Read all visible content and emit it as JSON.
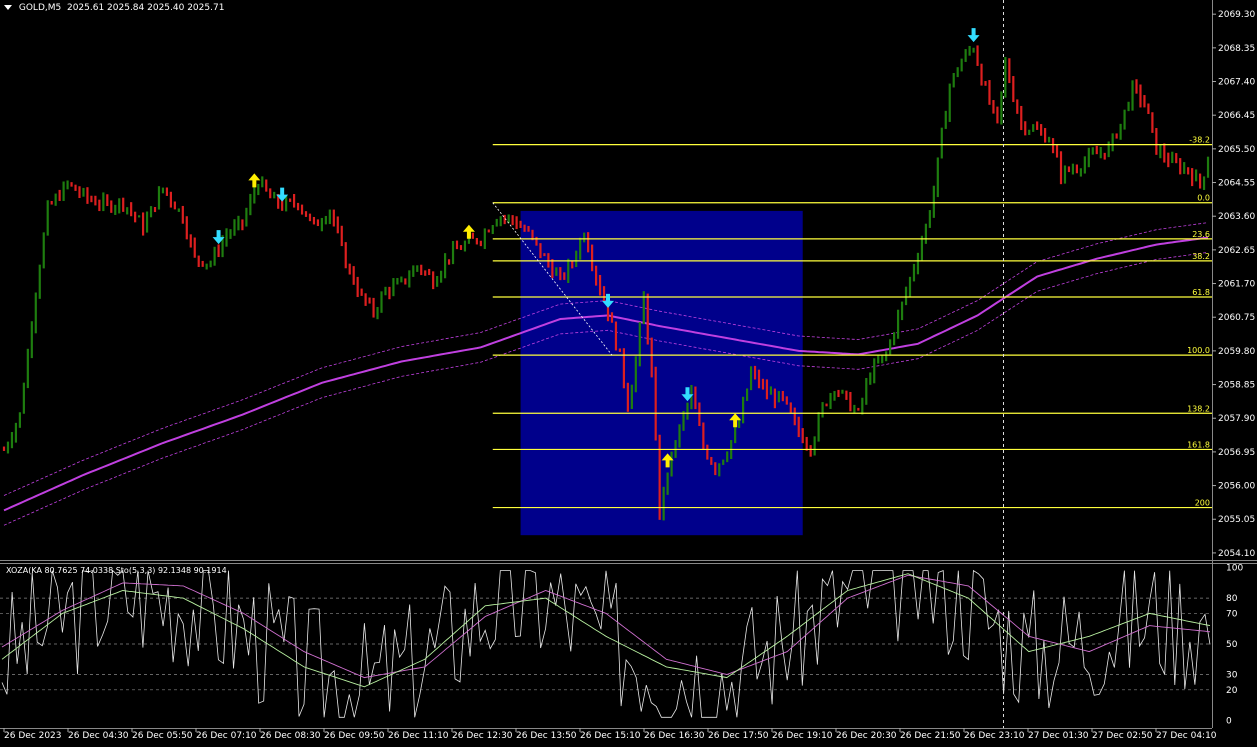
{
  "header": {
    "symbol": "GOLD,M5",
    "ohlc": "2025.61 2025.84 2025.40 2025.71"
  },
  "indicator_header": {
    "text": "XOZA(KA 80.7625 74.0338 Sto(5,3,3) 92.1348 90.1914"
  },
  "colors": {
    "background": "#000000",
    "bull_candle": "#1e7d0f",
    "bear_candle": "#dd1f1f",
    "fib_line": "#ffff3c",
    "fib_box": "#00008b",
    "ma_line": "#c040e0",
    "arrow_up": "#ffee00",
    "arrow_down": "#33ddff"
  },
  "chart_data": [
    {
      "type": "candlestick",
      "title": "GOLD,M5",
      "y_ticks": [
        "2069.30",
        "2068.35",
        "2067.40",
        "2066.45",
        "2065.50",
        "2064.55",
        "2063.60",
        "2062.65",
        "2061.70",
        "2060.75",
        "2059.80",
        "2058.85",
        "2057.90",
        "2056.95",
        "2056.00",
        "2055.05",
        "2054.10"
      ],
      "ylim": [
        2053.9,
        2069.7
      ],
      "x_ticks": [
        "26 Dec 2023",
        "26 Dec 04:30",
        "26 Dec 05:50",
        "26 Dec 07:10",
        "26 Dec 08:30",
        "26 Dec 09:50",
        "26 Dec 11:10",
        "26 Dec 12:30",
        "26 Dec 13:50",
        "26 Dec 15:10",
        "26 Dec 16:30",
        "26 Dec 17:50",
        "26 Dec 19:10",
        "26 Dec 20:30",
        "26 Dec 21:50",
        "26 Dec 23:10",
        "27 Dec 01:30",
        "27 Dec 02:50",
        "27 Dec 04:10"
      ],
      "close_path": [
        {
          "i": 0,
          "p": 2057.0
        },
        {
          "i": 4,
          "p": 2058.0
        },
        {
          "i": 8,
          "p": 2061.5
        },
        {
          "i": 11,
          "p": 2063.8
        },
        {
          "i": 16,
          "p": 2064.5
        },
        {
          "i": 21,
          "p": 2064.1
        },
        {
          "i": 26,
          "p": 2063.9
        },
        {
          "i": 30,
          "p": 2064.0
        },
        {
          "i": 35,
          "p": 2063.3
        },
        {
          "i": 40,
          "p": 2064.4
        },
        {
          "i": 45,
          "p": 2063.6
        },
        {
          "i": 48,
          "p": 2062.4
        },
        {
          "i": 52,
          "p": 2062.3
        },
        {
          "i": 56,
          "p": 2063.1
        },
        {
          "i": 60,
          "p": 2063.4
        },
        {
          "i": 64,
          "p": 2064.6
        },
        {
          "i": 67,
          "p": 2064.1
        },
        {
          "i": 70,
          "p": 2063.9
        },
        {
          "i": 74,
          "p": 2064.0
        },
        {
          "i": 78,
          "p": 2063.3
        },
        {
          "i": 82,
          "p": 2063.8
        },
        {
          "i": 86,
          "p": 2062.3
        },
        {
          "i": 90,
          "p": 2061.3
        },
        {
          "i": 93,
          "p": 2060.9
        },
        {
          "i": 96,
          "p": 2061.5
        },
        {
          "i": 100,
          "p": 2061.7
        },
        {
          "i": 104,
          "p": 2062.2
        },
        {
          "i": 108,
          "p": 2061.8
        },
        {
          "i": 112,
          "p": 2062.5
        },
        {
          "i": 116,
          "p": 2062.8
        },
        {
          "i": 120,
          "p": 2063.0
        },
        {
          "i": 124,
          "p": 2063.6
        },
        {
          "i": 128,
          "p": 2063.5
        },
        {
          "i": 132,
          "p": 2063.1
        },
        {
          "i": 136,
          "p": 2062.4
        },
        {
          "i": 140,
          "p": 2061.8
        },
        {
          "i": 143,
          "p": 2062.3
        },
        {
          "i": 146,
          "p": 2063.2
        },
        {
          "i": 149,
          "p": 2061.9
        },
        {
          "i": 152,
          "p": 2060.9
        },
        {
          "i": 155,
          "p": 2059.6
        },
        {
          "i": 157,
          "p": 2058.3
        },
        {
          "i": 159,
          "p": 2059.5
        },
        {
          "i": 161,
          "p": 2061.3
        },
        {
          "i": 163,
          "p": 2059.1
        },
        {
          "i": 165,
          "p": 2055.2
        },
        {
          "i": 167,
          "p": 2056.4
        },
        {
          "i": 170,
          "p": 2057.6
        },
        {
          "i": 173,
          "p": 2058.6
        },
        {
          "i": 176,
          "p": 2057.1
        },
        {
          "i": 179,
          "p": 2056.5
        },
        {
          "i": 182,
          "p": 2057.0
        },
        {
          "i": 185,
          "p": 2057.8
        },
        {
          "i": 188,
          "p": 2059.2
        },
        {
          "i": 192,
          "p": 2058.6
        },
        {
          "i": 196,
          "p": 2058.4
        },
        {
          "i": 200,
          "p": 2057.5
        },
        {
          "i": 203,
          "p": 2057.1
        },
        {
          "i": 206,
          "p": 2058.2
        },
        {
          "i": 209,
          "p": 2058.8
        },
        {
          "i": 212,
          "p": 2058.4
        },
        {
          "i": 215,
          "p": 2058.0
        },
        {
          "i": 218,
          "p": 2059.2
        },
        {
          "i": 222,
          "p": 2059.7
        },
        {
          "i": 226,
          "p": 2061.1
        },
        {
          "i": 229,
          "p": 2062.2
        },
        {
          "i": 232,
          "p": 2063.3
        },
        {
          "i": 234,
          "p": 2064.3
        },
        {
          "i": 236,
          "p": 2065.9
        },
        {
          "i": 238,
          "p": 2067.3
        },
        {
          "i": 241,
          "p": 2068.0
        },
        {
          "i": 244,
          "p": 2068.4
        },
        {
          "i": 246,
          "p": 2067.5
        },
        {
          "i": 248,
          "p": 2066.8
        },
        {
          "i": 250,
          "p": 2066.2
        },
        {
          "i": 252,
          "p": 2067.9
        },
        {
          "i": 254,
          "p": 2067.0
        },
        {
          "i": 256,
          "p": 2066.2
        },
        {
          "i": 260,
          "p": 2066.0
        },
        {
          "i": 263,
          "p": 2065.8
        },
        {
          "i": 266,
          "p": 2064.8
        },
        {
          "i": 270,
          "p": 2065.0
        },
        {
          "i": 274,
          "p": 2065.3
        },
        {
          "i": 278,
          "p": 2065.5
        },
        {
          "i": 281,
          "p": 2066.2
        },
        {
          "i": 284,
          "p": 2067.2
        },
        {
          "i": 287,
          "p": 2066.8
        },
        {
          "i": 290,
          "p": 2065.5
        },
        {
          "i": 294,
          "p": 2065.1
        },
        {
          "i": 298,
          "p": 2064.9
        },
        {
          "i": 301,
          "p": 2064.5
        },
        {
          "i": 303,
          "p": 2065.2
        }
      ],
      "arrows": [
        {
          "i": 54,
          "dir": "down"
        },
        {
          "i": 63,
          "dir": "up"
        },
        {
          "i": 70,
          "dir": "down"
        },
        {
          "i": 117,
          "dir": "up"
        },
        {
          "i": 152,
          "dir": "down"
        },
        {
          "i": 167,
          "dir": "up"
        },
        {
          "i": 172,
          "dir": "down"
        },
        {
          "i": 184,
          "dir": "up"
        },
        {
          "i": 244,
          "dir": "down"
        }
      ],
      "fibonacci": {
        "levels": [
          {
            "label": "-38.2",
            "price": 2065.62
          },
          {
            "label": "0.0",
            "price": 2063.98
          },
          {
            "label": "23.6",
            "price": 2062.96
          },
          {
            "label": "38.2",
            "price": 2062.34
          },
          {
            "label": "61.8",
            "price": 2061.32
          },
          {
            "label": "100.0",
            "price": 2059.68
          },
          {
            "label": "138.2",
            "price": 2058.04
          },
          {
            "label": "161.8",
            "price": 2057.02
          },
          {
            "label": "200",
            "price": 2055.38
          }
        ],
        "box": {
          "i_from": 130,
          "i_to": 201,
          "p_top": 2063.75,
          "p_bottom": 2054.6
        },
        "line_from_i": 123,
        "line_to_i": 303
      },
      "moving_average": [
        {
          "i": 0,
          "p": 2055.3
        },
        {
          "i": 20,
          "p": 2056.3
        },
        {
          "i": 40,
          "p": 2057.2
        },
        {
          "i": 60,
          "p": 2058.0
        },
        {
          "i": 80,
          "p": 2058.9
        },
        {
          "i": 100,
          "p": 2059.5
        },
        {
          "i": 120,
          "p": 2059.9
        },
        {
          "i": 140,
          "p": 2060.7
        },
        {
          "i": 152,
          "p": 2060.8
        },
        {
          "i": 165,
          "p": 2060.5
        },
        {
          "i": 180,
          "p": 2060.2
        },
        {
          "i": 200,
          "p": 2059.8
        },
        {
          "i": 215,
          "p": 2059.7
        },
        {
          "i": 230,
          "p": 2060.0
        },
        {
          "i": 245,
          "p": 2060.8
        },
        {
          "i": 260,
          "p": 2061.9
        },
        {
          "i": 275,
          "p": 2062.4
        },
        {
          "i": 290,
          "p": 2062.8
        },
        {
          "i": 303,
          "p": 2063.0
        }
      ]
    },
    {
      "type": "line",
      "title": "XOZA(KA 80.7625 74.0338 Sto(5,3,3) 92.1348 90.1914",
      "y_ticks": [
        "100",
        "80",
        "70",
        "50",
        "30",
        "20",
        "0"
      ],
      "ylim": [
        -5,
        103
      ],
      "series_xoza": [
        {
          "t": 0,
          "v": 48
        },
        {
          "t": 0.05,
          "v": 72
        },
        {
          "t": 0.1,
          "v": 90
        },
        {
          "t": 0.15,
          "v": 88
        },
        {
          "t": 0.2,
          "v": 70
        },
        {
          "t": 0.25,
          "v": 45
        },
        {
          "t": 0.3,
          "v": 28
        },
        {
          "t": 0.35,
          "v": 35
        },
        {
          "t": 0.4,
          "v": 68
        },
        {
          "t": 0.45,
          "v": 85
        },
        {
          "t": 0.5,
          "v": 70
        },
        {
          "t": 0.55,
          "v": 40
        },
        {
          "t": 0.6,
          "v": 30
        },
        {
          "t": 0.65,
          "v": 45
        },
        {
          "t": 0.7,
          "v": 80
        },
        {
          "t": 0.75,
          "v": 95
        },
        {
          "t": 0.8,
          "v": 88
        },
        {
          "t": 0.85,
          "v": 55
        },
        {
          "t": 0.9,
          "v": 45
        },
        {
          "t": 0.95,
          "v": 62
        },
        {
          "t": 1,
          "v": 58
        }
      ],
      "series_sto": [
        {
          "t": 0,
          "v": 40
        },
        {
          "t": 0.05,
          "v": 70
        },
        {
          "t": 0.1,
          "v": 85
        },
        {
          "t": 0.15,
          "v": 80
        },
        {
          "t": 0.2,
          "v": 60
        },
        {
          "t": 0.25,
          "v": 35
        },
        {
          "t": 0.3,
          "v": 22
        },
        {
          "t": 0.35,
          "v": 40
        },
        {
          "t": 0.4,
          "v": 75
        },
        {
          "t": 0.45,
          "v": 80
        },
        {
          "t": 0.5,
          "v": 55
        },
        {
          "t": 0.55,
          "v": 35
        },
        {
          "t": 0.6,
          "v": 28
        },
        {
          "t": 0.65,
          "v": 55
        },
        {
          "t": 0.7,
          "v": 85
        },
        {
          "t": 0.75,
          "v": 96
        },
        {
          "t": 0.8,
          "v": 80
        },
        {
          "t": 0.85,
          "v": 45
        },
        {
          "t": 0.9,
          "v": 55
        },
        {
          "t": 0.95,
          "v": 70
        },
        {
          "t": 1,
          "v": 62
        }
      ]
    }
  ]
}
